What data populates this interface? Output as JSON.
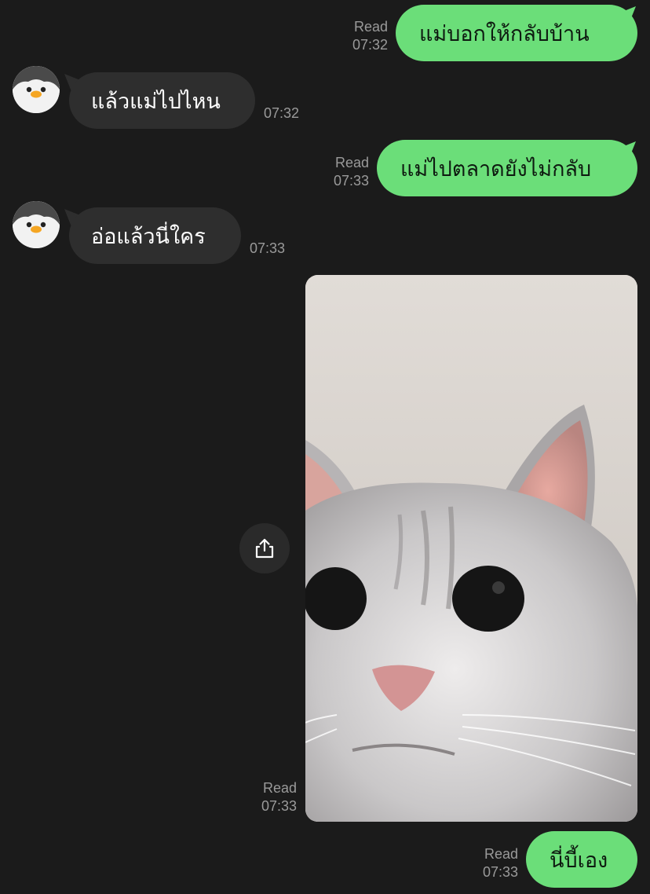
{
  "messages": [
    {
      "side": "out",
      "text": "แม่บอกให้กลับบ้าน",
      "status": "Read",
      "time": "07:32"
    },
    {
      "side": "in",
      "text": "แล้วแม่ไปไหน",
      "time": "07:32"
    },
    {
      "side": "out",
      "text": "แม่ไปตลาดยังไม่กลับ",
      "status": "Read",
      "time": "07:33"
    },
    {
      "side": "in",
      "text": "อ่อแล้วนี่ใคร",
      "time": "07:33"
    },
    {
      "side": "out",
      "type": "image",
      "image": "cat-photo",
      "status": "Read",
      "time": "07:33"
    },
    {
      "side": "out",
      "text": "นี่บี้เอง",
      "status": "Read",
      "time": "07:33"
    }
  ],
  "icons": {
    "avatar": "penguin-avatar-icon",
    "share": "share-icon"
  },
  "colors": {
    "background": "#1b1b1b",
    "outgoing_bubble": "#6bde79",
    "incoming_bubble": "#2e2e2e",
    "meta_text": "#9a9a9a"
  }
}
